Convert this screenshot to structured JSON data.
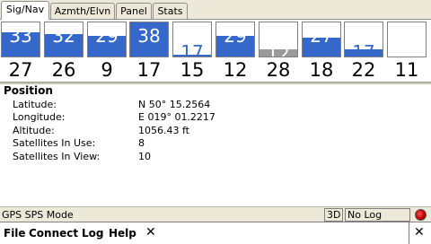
{
  "tabs": [
    {
      "label": "Sig/Nav",
      "active": true
    },
    {
      "label": "Azmth/Elvn",
      "active": false
    },
    {
      "label": "Panel",
      "active": false
    },
    {
      "label": "Stats",
      "active": false
    }
  ],
  "satellites": [
    {
      "prn": "27",
      "snr": "33",
      "fill": 0.7,
      "color": "blue"
    },
    {
      "prn": "26",
      "snr": "32",
      "fill": 0.67,
      "color": "blue"
    },
    {
      "prn": "9",
      "snr": "29",
      "fill": 0.6,
      "color": "blue"
    },
    {
      "prn": "17",
      "snr": "38",
      "fill": 1.0,
      "color": "blue"
    },
    {
      "prn": "15",
      "snr": "17",
      "fill": 0.05,
      "color": "blue"
    },
    {
      "prn": "12",
      "snr": "29",
      "fill": 0.6,
      "color": "blue"
    },
    {
      "prn": "28",
      "snr": "12",
      "fill": 0.2,
      "color": "gray"
    },
    {
      "prn": "18",
      "snr": "27",
      "fill": 0.55,
      "color": "blue"
    },
    {
      "prn": "22",
      "snr": "17",
      "fill": 0.22,
      "color": "blue"
    },
    {
      "prn": "11",
      "snr": "",
      "fill": 0.0,
      "color": "blue"
    }
  ],
  "position": {
    "title": "Position",
    "rows": [
      {
        "label": "Latitude:",
        "value": "N 50° 15.2564"
      },
      {
        "label": "Longitude:",
        "value": "E 019° 01.2217"
      },
      {
        "label": "Altitude:",
        "value": "1056.43  ft"
      },
      {
        "label": "Satellites In Use:",
        "value": "8"
      },
      {
        "label": "Satellites In View:",
        "value": "10"
      }
    ]
  },
  "status": {
    "mode": "GPS SPS Mode",
    "fix": "3D",
    "log": "No Log",
    "led_color": "#cc0000"
  },
  "menu": {
    "items": [
      "File",
      "Connect",
      "Log",
      "Help"
    ],
    "close_glyph": "✕"
  },
  "colors": {
    "signal_blue": "#3568c9",
    "signal_gray": "#9a9a9a"
  }
}
